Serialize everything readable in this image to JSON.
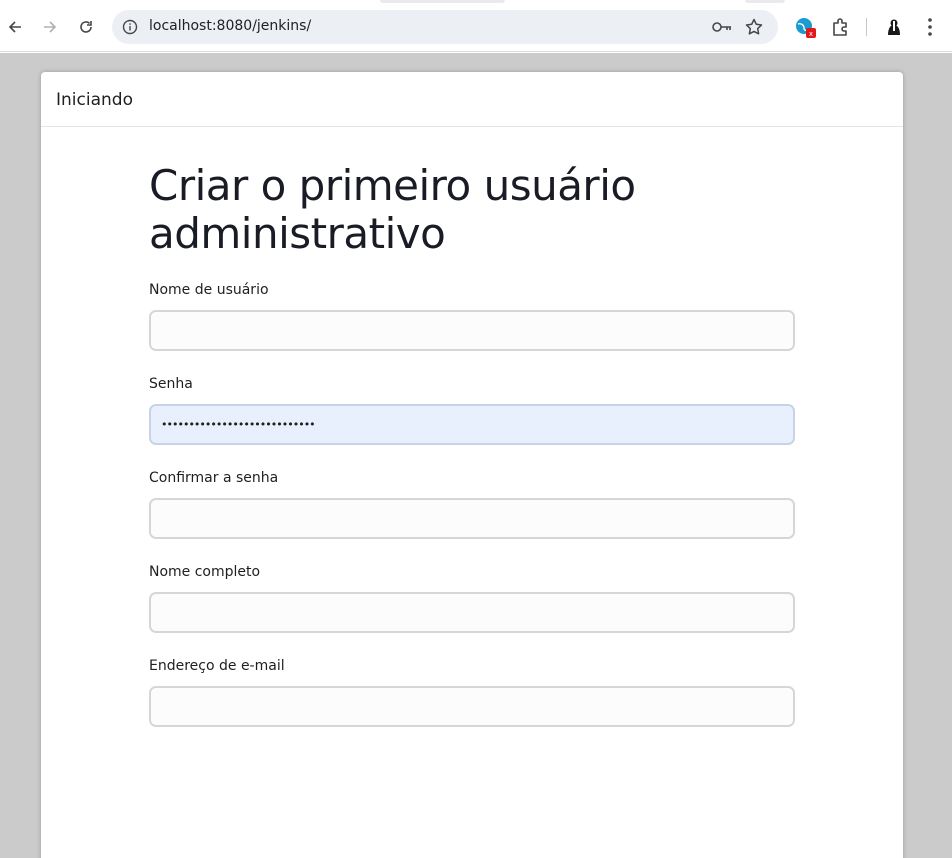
{
  "browser": {
    "url": "localhost:8080/jenkins/",
    "icons": {
      "back": "arrow-left-icon",
      "forward": "arrow-right-icon",
      "reload": "reload-icon",
      "site_info": "info-icon",
      "password": "key-icon",
      "bookmark": "star-icon",
      "extension_1": "translate-extension-icon",
      "extensions": "puzzle-icon",
      "profile": "profile-avatar-icon",
      "menu": "kebab-menu-icon"
    }
  },
  "dialog": {
    "header_title": "Iniciando",
    "heading": "Criar o primeiro usuário administrativo",
    "fields": [
      {
        "label": "Nome de usuário",
        "value": "",
        "type": "text"
      },
      {
        "label": "Senha",
        "value": "••••••••••••••••••••••••••••",
        "type": "password"
      },
      {
        "label": "Confirmar a senha",
        "value": "",
        "type": "password"
      },
      {
        "label": "Nome completo",
        "value": "",
        "type": "text"
      },
      {
        "label": "Endereço de e-mail",
        "value": "",
        "type": "email"
      }
    ]
  },
  "colors": {
    "backdrop": "#cbcbcb",
    "autofill": "#e8f0fe",
    "input_border": "#d6d6d8"
  }
}
